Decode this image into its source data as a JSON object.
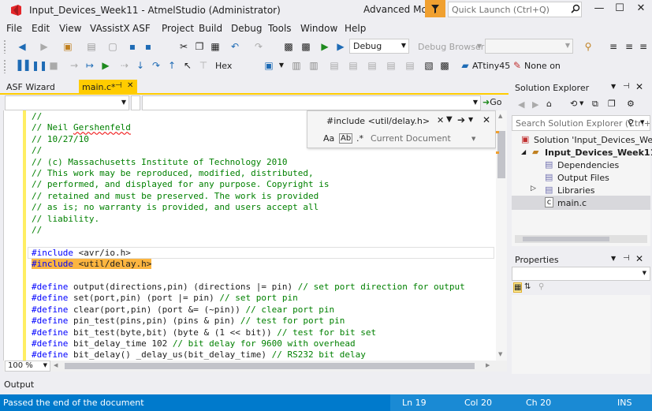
{
  "titlebar": {
    "title": "Input_Devices_Week11 - AtmelStudio (Administrator)",
    "mode": "Advanced Mode",
    "quick_launch_placeholder": "Quick Launch (Ctrl+Q)",
    "minimize": "—",
    "maximize": "☐",
    "close": "✕"
  },
  "menu": [
    "File",
    "Edit",
    "View",
    "VAssistX",
    "ASF",
    "Project",
    "Build",
    "Debug",
    "Tools",
    "Window",
    "Help"
  ],
  "toolbar1": {
    "config": "Debug",
    "debug_browser": "Debug Browser"
  },
  "toolbar2": {
    "hex": "Hex",
    "device": "ATtiny45",
    "tool": "None on"
  },
  "tabs": {
    "asf_wizard": "ASF Wizard",
    "main_c": "main.c*",
    "pin": "⊣",
    "close": "✕"
  },
  "navbar": {
    "go": "Go"
  },
  "find": {
    "query": "#include <util/delay.h>",
    "scope": "Current Document",
    "opt_case": "Aa",
    "opt_word": "Ab",
    "opt_regex": ".*"
  },
  "code": [
    {
      "t": "//",
      "c": "cm"
    },
    {
      "t": "// Neil Gershenfeld",
      "c": "cm",
      "ul": "Gershenfeld"
    },
    {
      "t": "// 10/27/10",
      "c": "cm"
    },
    {
      "t": "//",
      "c": "cm"
    },
    {
      "t": "// (c) Massachusetts Institute of Technology 2010",
      "c": "cm"
    },
    {
      "t": "// This work may be reproduced, modified, distributed,",
      "c": "cm"
    },
    {
      "t": "// performed, and displayed for any purpose. Copyright is",
      "c": "cm"
    },
    {
      "t": "// retained and must be preserved. The work is provided",
      "c": "cm"
    },
    {
      "t": "// as is; no warranty is provided, and users accept all",
      "c": "cm"
    },
    {
      "t": "// liability.",
      "c": "cm"
    },
    {
      "t": "//",
      "c": "cm"
    },
    {
      "t": "",
      "c": ""
    },
    {
      "t": "#include <avr/io.h>",
      "c": "inc"
    },
    {
      "t": "#include <util/delay.h>",
      "c": "inchl"
    },
    {
      "t": "",
      "c": ""
    },
    {
      "t": "#define output(directions,pin) (directions |= pin) // set port direction for output",
      "c": "def"
    },
    {
      "t": "#define set(port,pin) (port |= pin) // set port pin",
      "c": "def"
    },
    {
      "t": "#define clear(port,pin) (port &= (~pin)) // clear port pin",
      "c": "def"
    },
    {
      "t": "#define pin_test(pins,pin) (pins & pin) // test for port pin",
      "c": "def"
    },
    {
      "t": "#define bit_test(byte,bit) (byte & (1 << bit)) // test for bit set",
      "c": "def"
    },
    {
      "t": "#define bit_delay_time 102 // bit delay for 9600 with overhead",
      "c": "def"
    },
    {
      "t": "#define bit_delay() _delay_us(bit_delay_time) // RS232 bit delay",
      "c": "def"
    }
  ],
  "zoom": "100 %",
  "solution_explorer": {
    "title": "Solution Explorer",
    "search_placeholder": "Search Solution Explorer (Ctrl+",
    "items": [
      {
        "label": "Solution 'Input_Devices_Week11",
        "bold": false,
        "indent": 0
      },
      {
        "label": "Input_Devices_Week11",
        "bold": true,
        "indent": 1
      },
      {
        "label": "Dependencies",
        "bold": false,
        "indent": 2
      },
      {
        "label": "Output Files",
        "bold": false,
        "indent": 2
      },
      {
        "label": "Libraries",
        "bold": false,
        "indent": 2
      },
      {
        "label": "main.c",
        "bold": false,
        "indent": 2
      }
    ]
  },
  "properties": {
    "title": "Properties"
  },
  "output": {
    "title": "Output"
  },
  "status": {
    "message": "Passed the end of the document",
    "ln": "Ln 19",
    "col": "Col 20",
    "ch": "Ch 20",
    "ins": "INS"
  },
  "colors": {
    "accent": "#007acc",
    "tab_active": "#ffcc00",
    "highlight": "#fcb540",
    "comment": "#008000",
    "keyword": "#0000ff"
  }
}
